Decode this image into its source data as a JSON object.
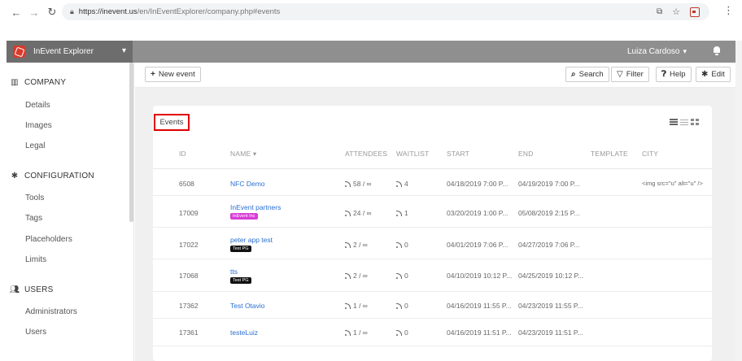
{
  "browser": {
    "url_host": "https://inevent.us",
    "url_path": "/en/InEventExplorer/company.php#events",
    "icons": [
      "back-icon",
      "forward-icon",
      "reload-icon",
      "lock-icon",
      "translate-icon",
      "star-icon",
      "extension-icon",
      "kebab-icon"
    ]
  },
  "header": {
    "brand": "InEvent Explorer",
    "user": "Luiza Cardoso"
  },
  "sidebar": {
    "company": {
      "title": "COMPANY",
      "items": [
        "Details",
        "Images",
        "Legal"
      ]
    },
    "configuration": {
      "title": "CONFIGURATION",
      "items": [
        "Tools",
        "Tags",
        "Placeholders",
        "Limits"
      ]
    },
    "users": {
      "title": "USERS",
      "items": [
        "Administrators",
        "Users"
      ]
    }
  },
  "toolbar": {
    "new_event": "New event",
    "search": "Search",
    "filter": "Filter",
    "help": "Help",
    "edit": "Edit"
  },
  "card": {
    "title": "Events",
    "columns": [
      "ID",
      "NAME",
      "ATTENDEES",
      "WAITLIST",
      "START",
      "END",
      "TEMPLATE",
      "CITY"
    ]
  },
  "events": [
    {
      "id": "6508",
      "name": "NFC Demo",
      "tag": "",
      "attendees": "58 / ∞",
      "waitlist": "4",
      "start": "04/18/2019 7:00 P...",
      "end": "04/19/2019 7:00 P...",
      "template": "",
      "city": "<img src=\"u\" alt=\"u\" />"
    },
    {
      "id": "17009",
      "name": "InEvent partners",
      "tag": "InEvent Inc",
      "tag_color": "#d63fd6",
      "attendees": "24 / ∞",
      "waitlist": "1",
      "start": "03/20/2019 1:00 P...",
      "end": "05/08/2019 2:15 P...",
      "template": "",
      "city": ""
    },
    {
      "id": "17022",
      "name": "peter app test",
      "tag": "Test PG",
      "tag_color": "#111111",
      "attendees": "2 / ∞",
      "waitlist": "0",
      "start": "04/01/2019 7:06 P...",
      "end": "04/27/2019 7:06 P...",
      "template": "",
      "city": ""
    },
    {
      "id": "17068",
      "name": "tts",
      "tag": "Test PG",
      "tag_color": "#111111",
      "attendees": "2 / ∞",
      "waitlist": "0",
      "start": "04/10/2019 10:12 P...",
      "end": "04/25/2019 10:12 P...",
      "template": "",
      "city": ""
    },
    {
      "id": "17362",
      "name": "Test Otavio",
      "tag": "",
      "attendees": "1 / ∞",
      "waitlist": "0",
      "start": "04/16/2019 11:55 P...",
      "end": "04/23/2019 11:55 P...",
      "template": "",
      "city": ""
    },
    {
      "id": "17361",
      "name": "testeLuiz",
      "tag": "",
      "attendees": "1 / ∞",
      "waitlist": "0",
      "start": "04/16/2019 11:51 P...",
      "end": "04/23/2019 11:51 P...",
      "template": "",
      "city": ""
    }
  ]
}
